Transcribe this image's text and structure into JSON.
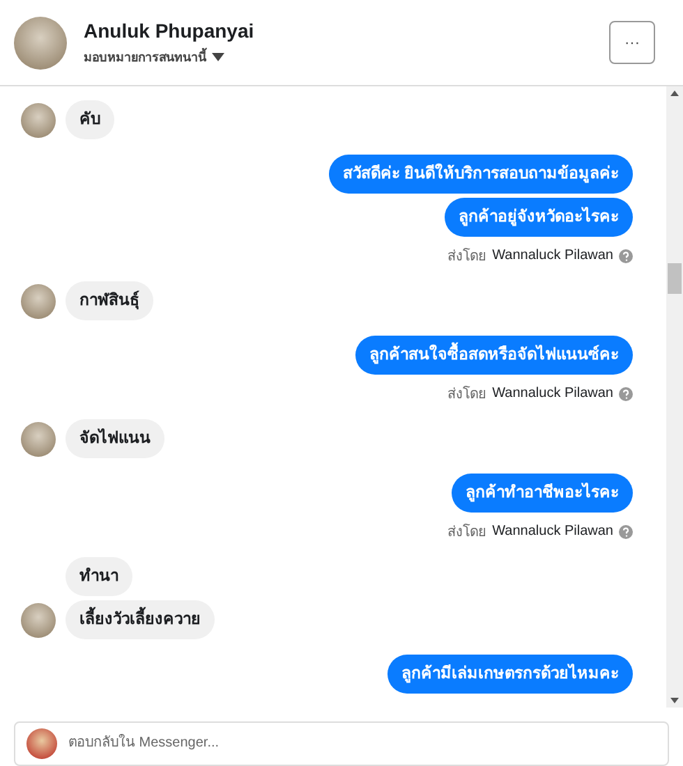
{
  "header": {
    "name": "Anuluk Phupanyai",
    "assign_label": "มอบหมายการสนทนานี้",
    "more_button": "···"
  },
  "messages": [
    {
      "kind": "incoming",
      "bubbles": [
        "คับ"
      ]
    },
    {
      "kind": "outgoing",
      "bubbles": [
        "สวัสดีค่ะ  ยินดีให้บริการสอบถามข้อมูลค่ะ",
        "ลูกค้าอยู่จังหวัดอะไรคะ"
      ],
      "sent_by_label": "ส่งโดย",
      "sent_by": "Wannaluck Pilawan"
    },
    {
      "kind": "incoming",
      "bubbles": [
        "กาฬสินธุ์"
      ]
    },
    {
      "kind": "outgoing",
      "bubbles": [
        "ลูกค้าสนใจซื้อสดหรือจัดไฟแนนซ์คะ"
      ],
      "sent_by_label": "ส่งโดย",
      "sent_by": "Wannaluck Pilawan"
    },
    {
      "kind": "incoming",
      "bubbles": [
        "จัดไฟแนน"
      ]
    },
    {
      "kind": "outgoing",
      "bubbles": [
        "ลูกค้าทำอาชีพอะไรคะ"
      ],
      "sent_by_label": "ส่งโดย",
      "sent_by": "Wannaluck Pilawan"
    },
    {
      "kind": "incoming",
      "bubbles": [
        "ทำนา",
        "เลี้ยงวัวเลี้ยงควาย"
      ]
    },
    {
      "kind": "outgoing",
      "bubbles": [
        "ลูกค้ามีเล่มเกษตรกรด้วยไหมคะ"
      ]
    }
  ],
  "composer": {
    "placeholder": "ตอบกลับใน Messenger..."
  }
}
